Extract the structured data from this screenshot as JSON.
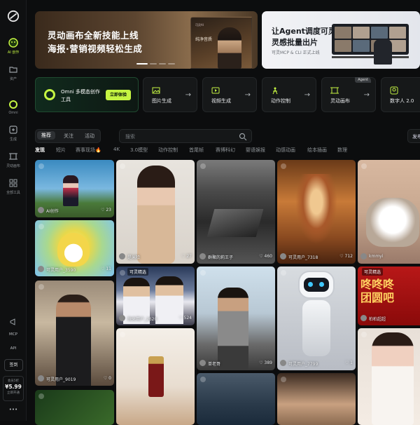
{
  "sidebar": {
    "items": [
      {
        "label": "AI 创作"
      },
      {
        "label": "资产"
      },
      {
        "label": "Omni"
      },
      {
        "label": "生成"
      },
      {
        "label": "灵动画布"
      },
      {
        "label": "全部工具"
      }
    ],
    "bottom": {
      "mcp": "MCP",
      "api": "API",
      "sign": "签到",
      "vip_t1": "会员5折",
      "vip_price": "¥5.99",
      "vip_t3": "立即开通",
      "more": "•••"
    }
  },
  "banners": [
    {
      "line1": "灵动画布全新技能上线",
      "line2": "海报·营销视频轻松生成",
      "card_title": "纯净音质",
      "card_sub": "可灵AI"
    },
    {
      "line1": "让Agent调度可灵",
      "line2": "灵感批量出片",
      "line3": "可灵MCP & CLI 正式上线"
    }
  ],
  "tools": {
    "omni": {
      "title": "Omni 多模态创作",
      "sub": "工具",
      "button": "立即体验"
    },
    "items": [
      {
        "name": "图片生成",
        "icon": "image-icon"
      },
      {
        "name": "视频生成",
        "icon": "video-icon"
      },
      {
        "name": "动作控制",
        "icon": "motion-icon"
      },
      {
        "name": "灵动画布",
        "icon": "canvas-icon",
        "badge": "Agent"
      },
      {
        "name": "数字人 2.0",
        "icon": "avatar-icon"
      }
    ]
  },
  "filters": {
    "tabs": [
      "推荐",
      "关注",
      "活动"
    ],
    "active": "推荐",
    "search_placeholder": "搜索",
    "publish": "发布"
  },
  "categories": [
    "发现",
    "短片",
    "赛事现场🔥",
    "4K",
    "3.0模型",
    "动作控制",
    "首尾帧",
    "赛博科幻",
    "婴语娱报",
    "动感动画",
    "绘本插画",
    "数理"
  ],
  "feed": [
    {
      "user": "AI创作",
      "likes": "23"
    },
    {
      "user": "是米哈",
      "likes": "27"
    },
    {
      "user": "群聚的莉王子",
      "likes": "460"
    },
    {
      "user": "可灵用户_7318",
      "likes": "712"
    },
    {
      "user": "kmmyi",
      "likes": ""
    },
    {
      "user": "可灵用户_3590",
      "likes": "11"
    },
    {
      "user": "快来用户_2620",
      "likes": "524"
    },
    {
      "user": "可灵用户_9019",
      "likes": "0"
    },
    {
      "user": "单老哥",
      "likes": "389"
    },
    {
      "user": "可灵用户_7799",
      "likes": "1"
    },
    {
      "user": "柏柏超超",
      "likes": ""
    },
    {
      "user": "",
      "likes": ""
    },
    {
      "user": "",
      "likes": ""
    },
    {
      "user": "",
      "likes": ""
    },
    {
      "user": "",
      "likes": ""
    }
  ],
  "feed_tags": {
    "baseball": "可灵精选",
    "poster": "可灵精选"
  },
  "poster_text": "咚咚咚\n团圆吧"
}
